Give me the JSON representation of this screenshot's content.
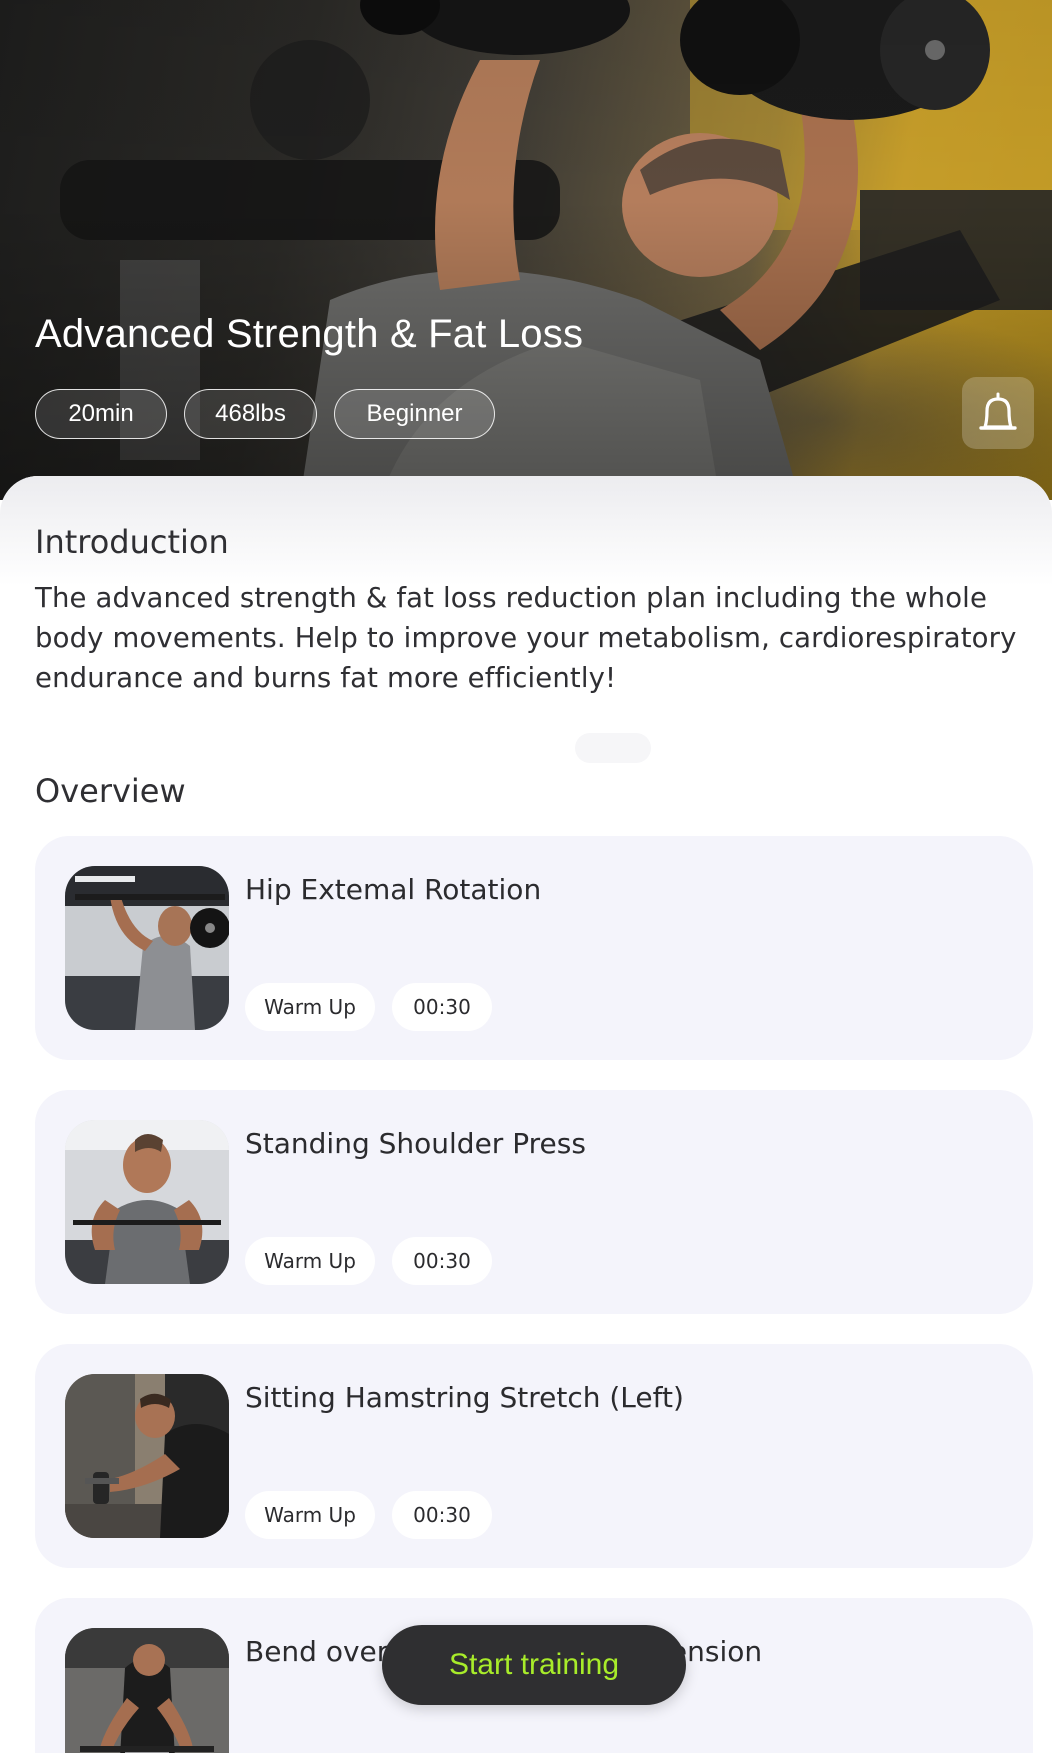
{
  "hero": {
    "title": "Advanced Strength & Fat Loss",
    "chips": [
      "20min",
      "468lbs",
      "Beginner"
    ],
    "bell_icon": "bell-icon"
  },
  "introduction": {
    "heading": "Introduction",
    "body": "The advanced strength & fat loss reduction plan including the whole body movements. Help to improve your metabolism, cardiorespiratory endurance and burns fat more efficiently!"
  },
  "overview": {
    "heading": "Overview",
    "exercises": [
      {
        "name": "Hip Extemal Rotation",
        "category": "Warm Up",
        "duration": "00:30"
      },
      {
        "name": "Standing Shoulder Press",
        "category": "Warm Up",
        "duration": "00:30"
      },
      {
        "name": "Sitting Hamstring Stretch (Left)",
        "category": "Warm Up",
        "duration": "00:30"
      },
      {
        "name": "Bend over arm flexion and extension",
        "category": "",
        "duration": ""
      }
    ]
  },
  "start_button": {
    "label": "Start training"
  },
  "colors": {
    "accent_text": "#a8ec2a",
    "button_bg": "#2f2f31",
    "card_bg": "#f4f4fb"
  }
}
